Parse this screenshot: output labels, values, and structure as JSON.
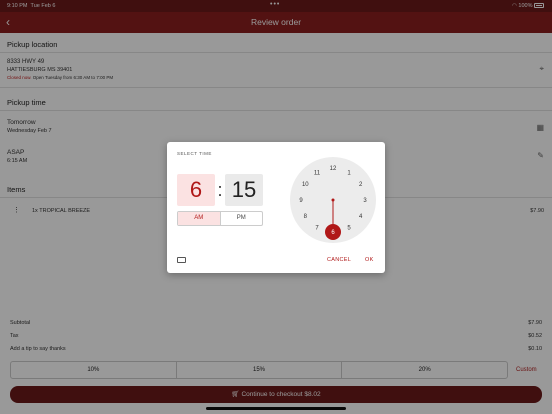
{
  "status": {
    "time": "9:10 PM",
    "date": "Tue Feb 6",
    "battery": "100%"
  },
  "appbar": {
    "back_icon": "chevron-left-icon",
    "title": "Review order"
  },
  "pickup_location": {
    "heading": "Pickup location",
    "address1": "8333 HWY 49",
    "address2": "HATTIESBURG MS 39401",
    "closed_label": "Closed now.",
    "hours": "Open Tuesday from 6:30 AM to 7:00 PM"
  },
  "pickup_time": {
    "heading": "Pickup time",
    "day": "Tomorrow",
    "date": "Wednesday Feb 7",
    "slot": "ASAP",
    "slot_time": "6:15 AM"
  },
  "items": {
    "heading": "Items",
    "list": [
      {
        "name": "1x TROPICAL BREEZE",
        "price": "$7.90"
      }
    ]
  },
  "totals": {
    "subtotal_label": "Subtotal",
    "subtotal": "$7.90",
    "tax_label": "Tax",
    "tax": "$0.52",
    "tip_label": "Add a tip to say thanks",
    "tip": "$0.10"
  },
  "tips": [
    "10%",
    "15%",
    "20%"
  ],
  "custom_label": "Custom",
  "checkout_label": "Continue to checkout $8.02",
  "dialog": {
    "title": "SELECT TIME",
    "hour": "6",
    "separator": ":",
    "minute": "15",
    "am": "AM",
    "pm": "PM",
    "selected_period": "AM",
    "selected_hour": 6,
    "clock_numbers": [
      "12",
      "1",
      "2",
      "3",
      "4",
      "5",
      "6",
      "7",
      "8",
      "9",
      "10",
      "11"
    ],
    "cancel": "CANCEL",
    "ok": "OK"
  },
  "colors": {
    "brand": "#8b1f1f",
    "accent": "#b01818"
  }
}
